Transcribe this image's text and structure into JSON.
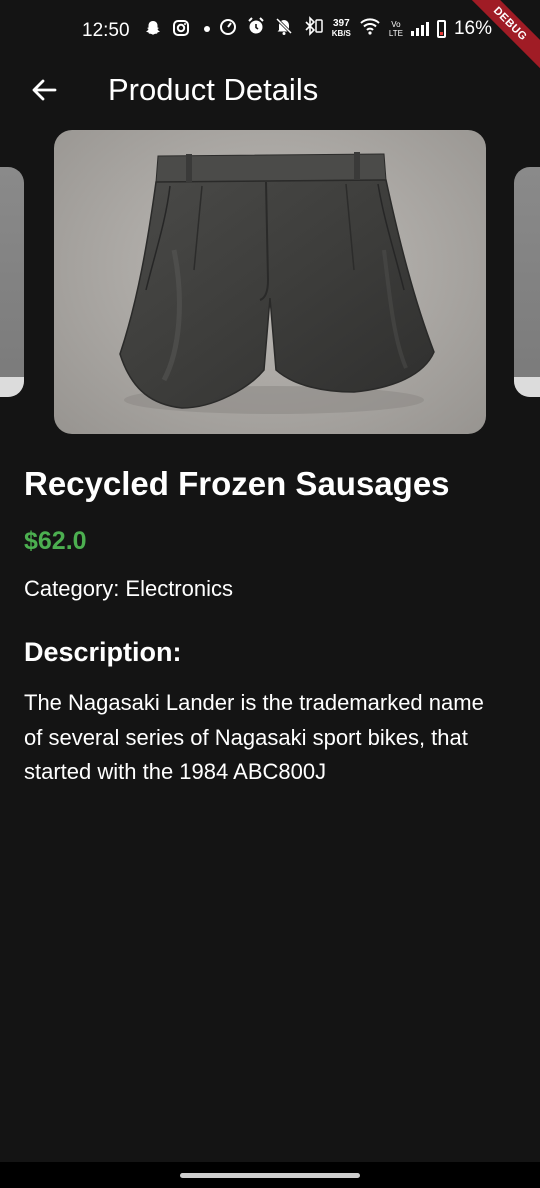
{
  "status_bar": {
    "time": "12:50",
    "network_speed_value": "397",
    "network_speed_unit": "KB/S",
    "volte_top": "Vo",
    "volte_bottom": "LTE",
    "battery_percent": "16%",
    "left_icons": [
      "snapchat-icon",
      "instagram-icon",
      "dot-icon"
    ],
    "right_icons": [
      "speedometer-icon",
      "alarm-icon",
      "bell-off-icon",
      "bluetooth-icon",
      "wifi-icon",
      "signal-icon",
      "battery-icon"
    ]
  },
  "debug_banner": "DEBUG",
  "app_bar": {
    "title": "Product Details",
    "back_icon": "arrow-back-icon"
  },
  "product": {
    "title": "Recycled Frozen Sausages",
    "price": "$62.0",
    "category_label": "Category:",
    "category_value": "Electronics",
    "description_heading": "Description:",
    "description": "The Nagasaki Lander is the trademarked name of several series of Nagasaki sport bikes, that started with the 1984 ABC800J",
    "image_icon": "shorts-image"
  },
  "colors": {
    "background": "#141414",
    "price": "#4caf50",
    "debug_ribbon": "#a01c25"
  }
}
